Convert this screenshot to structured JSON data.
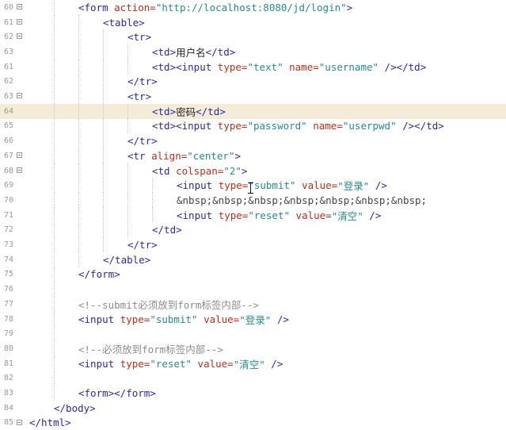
{
  "editor": {
    "current_line_index": 7,
    "lines": [
      {
        "num": "60",
        "fold": true,
        "indent": 2,
        "tokens": [
          {
            "t": "tag",
            "v": "<form "
          },
          {
            "t": "attr",
            "v": "action="
          },
          {
            "t": "val",
            "v": "\"http://localhost:8080/jd/login\""
          },
          {
            "t": "tag",
            "v": ">"
          }
        ]
      },
      {
        "num": "61",
        "fold": true,
        "indent": 3,
        "tokens": [
          {
            "t": "tag",
            "v": "<table>"
          }
        ]
      },
      {
        "num": "62",
        "fold": true,
        "indent": 4,
        "tokens": [
          {
            "t": "tag",
            "v": "<tr>"
          }
        ]
      },
      {
        "num": "63",
        "fold": false,
        "indent": 5,
        "tokens": [
          {
            "t": "tag",
            "v": "<td>"
          },
          {
            "t": "text",
            "v": "用户名"
          },
          {
            "t": "tag",
            "v": "</td>"
          }
        ]
      },
      {
        "num": "61",
        "fold": false,
        "indent": 5,
        "tokens": [
          {
            "t": "tag",
            "v": "<td><input "
          },
          {
            "t": "attr",
            "v": "type="
          },
          {
            "t": "val",
            "v": "\"text\""
          },
          {
            "t": "tag",
            "v": " "
          },
          {
            "t": "attr",
            "v": "name="
          },
          {
            "t": "val",
            "v": "\"username\""
          },
          {
            "t": "tag",
            "v": " /></td>"
          }
        ]
      },
      {
        "num": "62",
        "fold": false,
        "indent": 4,
        "tokens": [
          {
            "t": "tag",
            "v": "</tr>"
          }
        ]
      },
      {
        "num": "63",
        "fold": true,
        "indent": 4,
        "tokens": [
          {
            "t": "tag",
            "v": "<tr>"
          }
        ]
      },
      {
        "num": "64",
        "fold": false,
        "indent": 5,
        "tokens": [
          {
            "t": "tag",
            "v": "<td>"
          },
          {
            "t": "text",
            "v": "密码"
          },
          {
            "t": "tag",
            "v": "</td>"
          }
        ]
      },
      {
        "num": "65",
        "fold": false,
        "indent": 5,
        "tokens": [
          {
            "t": "tag",
            "v": "<td><input "
          },
          {
            "t": "attr",
            "v": "type="
          },
          {
            "t": "val",
            "v": "\"password\""
          },
          {
            "t": "tag",
            "v": " "
          },
          {
            "t": "attr",
            "v": "name="
          },
          {
            "t": "val",
            "v": "\"userpwd\""
          },
          {
            "t": "tag",
            "v": " /></td>"
          }
        ]
      },
      {
        "num": "66",
        "fold": false,
        "indent": 4,
        "tokens": [
          {
            "t": "tag",
            "v": "</tr>"
          }
        ]
      },
      {
        "num": "67",
        "fold": true,
        "indent": 4,
        "tokens": [
          {
            "t": "tag",
            "v": "<tr "
          },
          {
            "t": "attr",
            "v": "align="
          },
          {
            "t": "val",
            "v": "\"center\""
          },
          {
            "t": "tag",
            "v": ">"
          }
        ]
      },
      {
        "num": "68",
        "fold": true,
        "indent": 5,
        "tokens": [
          {
            "t": "tag",
            "v": "<td "
          },
          {
            "t": "attr",
            "v": "colspan="
          },
          {
            "t": "val",
            "v": "\"2\""
          },
          {
            "t": "tag",
            "v": ">"
          }
        ]
      },
      {
        "num": "69",
        "fold": false,
        "indent": 6,
        "tokens": [
          {
            "t": "tag",
            "v": "<input "
          },
          {
            "t": "attr",
            "v": "type="
          },
          {
            "t": "val",
            "v": "\"submit\""
          },
          {
            "t": "tag",
            "v": " "
          },
          {
            "t": "attr",
            "v": "value="
          },
          {
            "t": "val",
            "v": "\"登录\""
          },
          {
            "t": "tag",
            "v": " />"
          }
        ]
      },
      {
        "num": "70",
        "fold": false,
        "indent": 6,
        "tokens": [
          {
            "t": "ent",
            "v": "&nbsp;&nbsp;&nbsp;&nbsp;&nbsp;&nbsp;&nbsp;"
          }
        ]
      },
      {
        "num": "71",
        "fold": false,
        "indent": 6,
        "tokens": [
          {
            "t": "tag",
            "v": "<input "
          },
          {
            "t": "attr",
            "v": "type="
          },
          {
            "t": "val",
            "v": "\"reset\""
          },
          {
            "t": "tag",
            "v": " "
          },
          {
            "t": "attr",
            "v": "value="
          },
          {
            "t": "val",
            "v": "\"清空\""
          },
          {
            "t": "tag",
            "v": " />"
          }
        ]
      },
      {
        "num": "72",
        "fold": false,
        "indent": 5,
        "tokens": [
          {
            "t": "tag",
            "v": "</td>"
          }
        ]
      },
      {
        "num": "73",
        "fold": false,
        "indent": 4,
        "tokens": [
          {
            "t": "tag",
            "v": "</tr>"
          }
        ]
      },
      {
        "num": "74",
        "fold": false,
        "indent": 3,
        "tokens": [
          {
            "t": "tag",
            "v": "</table>"
          }
        ]
      },
      {
        "num": "75",
        "fold": false,
        "indent": 2,
        "tokens": [
          {
            "t": "tag",
            "v": "</form>"
          }
        ]
      },
      {
        "num": "76",
        "fold": false,
        "indent": 2,
        "tokens": []
      },
      {
        "num": "77",
        "fold": false,
        "indent": 2,
        "tokens": [
          {
            "t": "comment",
            "v": "<!--submit必须放到form标签内部-->"
          }
        ]
      },
      {
        "num": "78",
        "fold": false,
        "indent": 2,
        "tokens": [
          {
            "t": "tag",
            "v": "<input "
          },
          {
            "t": "attr",
            "v": "type="
          },
          {
            "t": "val",
            "v": "\"submit\""
          },
          {
            "t": "tag",
            "v": " "
          },
          {
            "t": "attr",
            "v": "value="
          },
          {
            "t": "val",
            "v": "\"登录\""
          },
          {
            "t": "tag",
            "v": " />"
          }
        ]
      },
      {
        "num": "79",
        "fold": false,
        "indent": 2,
        "tokens": []
      },
      {
        "num": "80",
        "fold": false,
        "indent": 2,
        "tokens": [
          {
            "t": "comment",
            "v": "<!--必须放到form标签内部-->"
          }
        ]
      },
      {
        "num": "81",
        "fold": false,
        "indent": 2,
        "tokens": [
          {
            "t": "tag",
            "v": "<input "
          },
          {
            "t": "attr",
            "v": "type="
          },
          {
            "t": "val",
            "v": "\"reset\""
          },
          {
            "t": "tag",
            "v": " "
          },
          {
            "t": "attr",
            "v": "value="
          },
          {
            "t": "val",
            "v": "\"清空\""
          },
          {
            "t": "tag",
            "v": " />"
          }
        ]
      },
      {
        "num": "82",
        "fold": false,
        "indent": 2,
        "tokens": []
      },
      {
        "num": "83",
        "fold": false,
        "indent": 2,
        "tokens": [
          {
            "t": "tag",
            "v": "<form></form>"
          }
        ]
      },
      {
        "num": "84",
        "fold": false,
        "indent": 1,
        "tokens": [
          {
            "t": "tag",
            "v": "</body>"
          }
        ]
      },
      {
        "num": "85",
        "fold": true,
        "indent": 0,
        "tokens": [
          {
            "t": "tag",
            "v": "</html>"
          }
        ]
      }
    ]
  },
  "colors": {
    "tag": "#2a2a9c",
    "attr": "#b5301d",
    "value": "#2a8a8a",
    "comment": "#8c8c8c",
    "current_line": "#f4ecd9",
    "gutter_text": "#9a9a9a"
  }
}
